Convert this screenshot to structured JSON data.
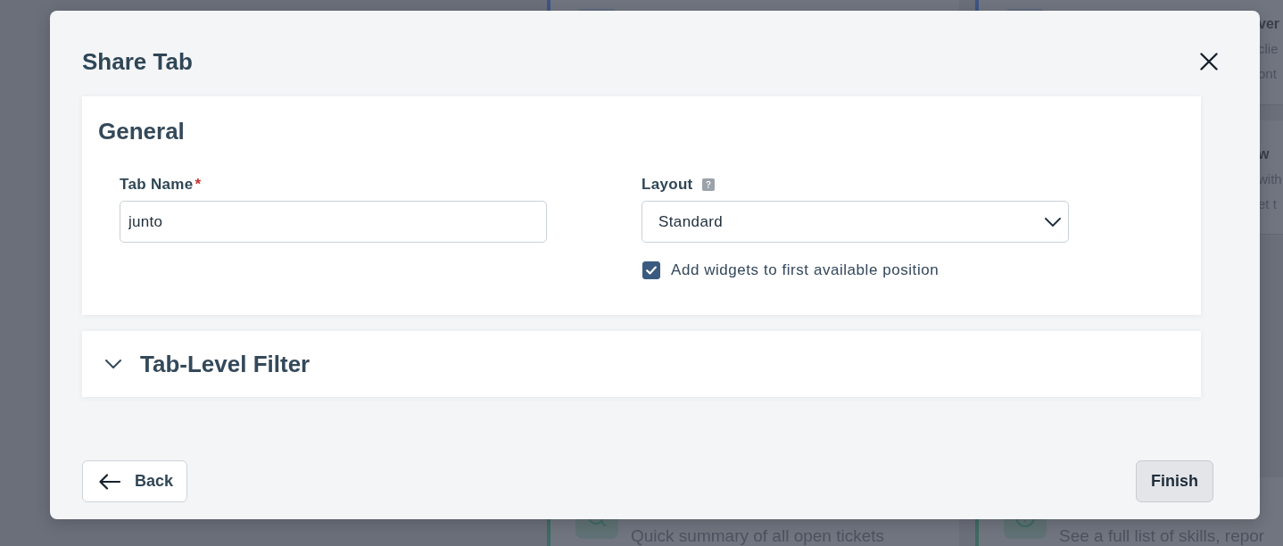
{
  "backdrop": {
    "columns": [
      {
        "cards": [
          {
            "kind": "clipped",
            "color": "#3d5686"
          },
          {
            "kind": "full",
            "color": "#3e6b63",
            "lines": [
              {
                "kind": "description",
                "text": "Quick summary of all open tickets"
              }
            ]
          }
        ]
      },
      {
        "cards": [
          {
            "kind": "clipped",
            "color": "#3d5686",
            "lines": [
              {
                "kind": "title",
                "text": "ver"
              },
              {
                "kind": "description",
                "text": "clie"
              },
              {
                "kind": "description",
                "text": "ont"
              }
            ]
          },
          {
            "kind": "clipped",
            "lines": [
              {
                "kind": "title",
                "text": "w"
              },
              {
                "kind": "description",
                "text": "with"
              },
              {
                "kind": "description",
                "text": "et t"
              }
            ]
          },
          {
            "kind": "full",
            "color": "#3e6b63",
            "lines": [
              {
                "kind": "description",
                "text": "See a full list of skills, repor"
              }
            ]
          }
        ]
      }
    ]
  },
  "dialog": {
    "title": "Share Tab",
    "general": {
      "heading": "General",
      "tab_name": {
        "label": "Tab Name",
        "required_mark": "*",
        "value": "junto"
      },
      "layout": {
        "label": "Layout",
        "value": "Standard"
      },
      "add_widgets": {
        "label": "Add widgets to first available position",
        "checked": true
      }
    },
    "tab_level_filter": {
      "heading": "Tab-Level Filter",
      "expanded": false
    },
    "buttons": [
      {
        "kind": "back",
        "label": "Back"
      },
      {
        "kind": "finish",
        "label": "Finish"
      }
    ]
  }
}
